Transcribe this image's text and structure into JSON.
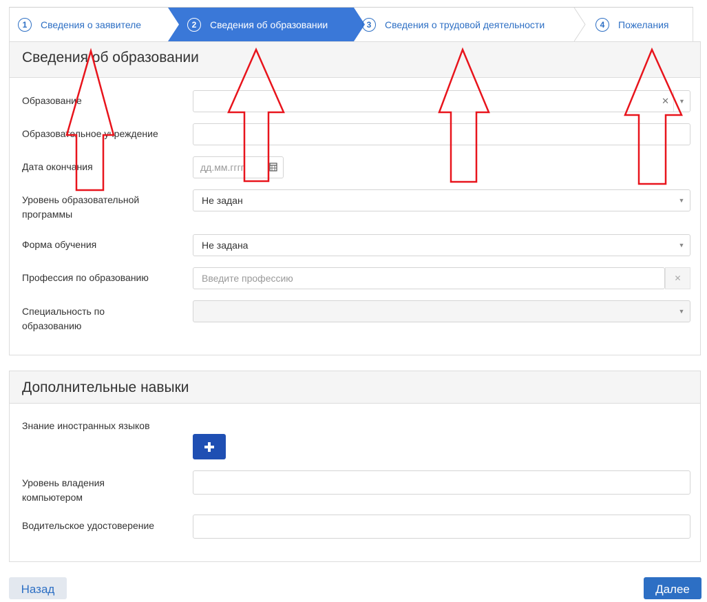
{
  "steps": [
    {
      "num": "1",
      "label": "Сведения о заявителе"
    },
    {
      "num": "2",
      "label": "Сведения об образовании"
    },
    {
      "num": "3",
      "label": "Сведения о трудовой деятельности"
    },
    {
      "num": "4",
      "label": "Пожелания"
    }
  ],
  "colors": {
    "accent": "#2d6fc4",
    "active_step": "#3a78d8",
    "primary_button": "#1f4fb3"
  },
  "education": {
    "title": "Сведения об образовании",
    "education_label": "Образование",
    "education_value": "",
    "institution_label": "Образовательное учреждение",
    "institution_value": "",
    "end_date_label": "Дата окончания",
    "end_date_placeholder": "дд.мм.гггг",
    "program_level_label": "Уровень образовательной программы",
    "program_level_value": "Не задан",
    "study_form_label": "Форма обучения",
    "study_form_value": "Не задана",
    "profession_label": "Профессия по образованию",
    "profession_placeholder": "Введите профессию",
    "specialty_label": "Специальность по образованию",
    "specialty_value": ""
  },
  "skills": {
    "title": "Дополнительные навыки",
    "languages_label": "Знание иностранных языков",
    "computer_label": "Уровень владения компьютером",
    "computer_value": "",
    "license_label": "Водительское удостоверение",
    "license_value": ""
  },
  "nav": {
    "back_label": "Назад",
    "next_label": "Далее"
  },
  "icons": {
    "calendar": "calendar-icon",
    "add": "plus-icon",
    "clear": "close-icon",
    "dropdown": "chevron-down-icon"
  }
}
